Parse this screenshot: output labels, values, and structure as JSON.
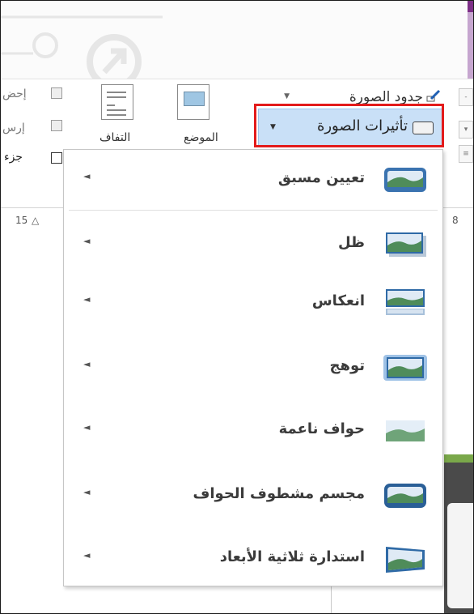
{
  "ribbon": {
    "picture_borders": "جدود الصورة",
    "picture_effects": "تأثيرات الصورة",
    "position_label": "الموضع",
    "wrap_text_label": "التفاف",
    "left_item_1": "إحض",
    "left_item_2": "إرس",
    "left_item_3": "جزء"
  },
  "ruler": {
    "left_number": "15",
    "right_number": "8"
  },
  "menu": {
    "items": [
      {
        "label": "تعيين مسبق",
        "icon": "preset-icon"
      },
      {
        "label": "ظل",
        "icon": "shadow-icon"
      },
      {
        "label": "انعكاس",
        "icon": "reflection-icon"
      },
      {
        "label": "توهج",
        "icon": "glow-icon"
      },
      {
        "label": "حواف ناعمة",
        "icon": "soft-edges-icon"
      },
      {
        "label": "مجسم مشطوف الحواف",
        "icon": "bevel-icon"
      },
      {
        "label": "استدارة ثلاثية الأبعاد",
        "icon": "3d-rotation-icon"
      }
    ]
  },
  "colors": {
    "highlight_border": "#e31b1b",
    "button_active": "#c9e0f7"
  }
}
